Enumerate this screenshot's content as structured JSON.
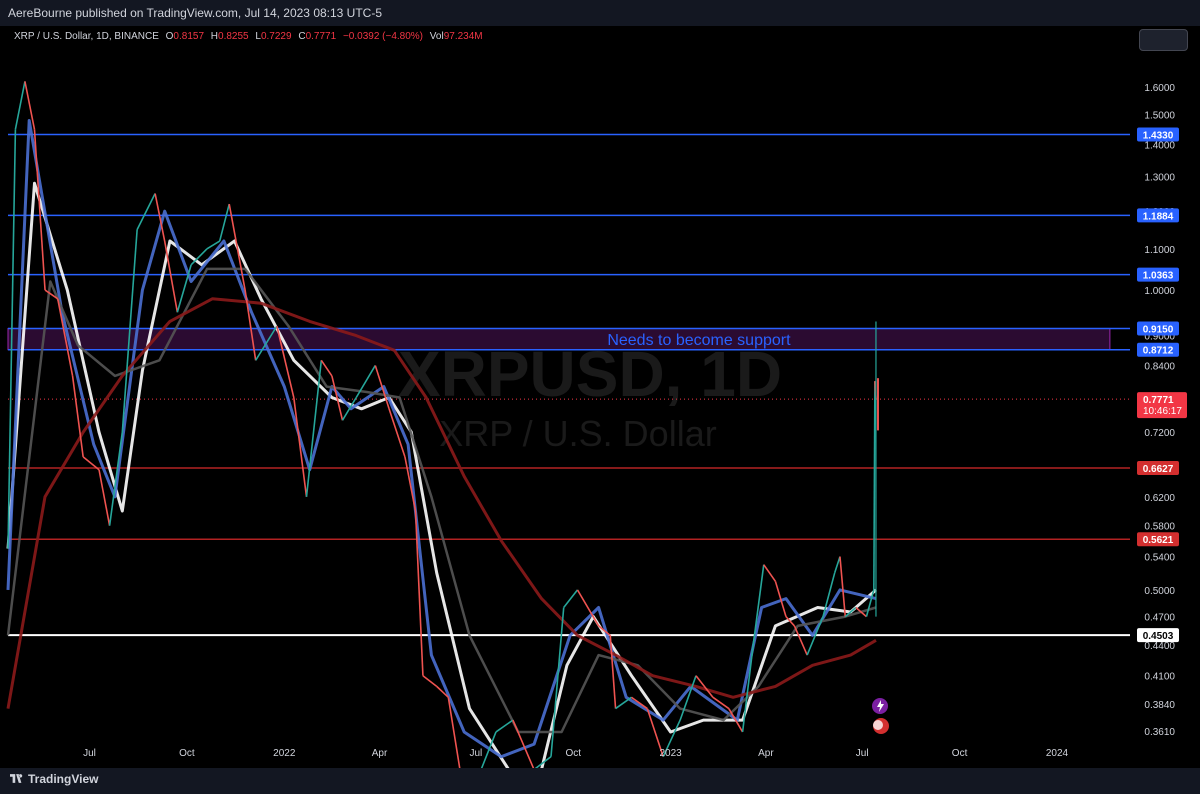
{
  "header": {
    "published_text": "AereBourne published on TradingView.com, Jul 14, 2023 08:13 UTC-5"
  },
  "symbol_bar": {
    "symbol": "XRP / U.S. Dollar, 1D, BINANCE",
    "open_label": "O",
    "open": "0.8157",
    "high_label": "H",
    "high": "0.8255",
    "low_label": "L",
    "low": "0.7229",
    "close_label": "C",
    "close": "0.7771",
    "change": "−0.0392 (−4.80%)",
    "vol_label": "Vol",
    "volume": "97.234M"
  },
  "watermark": {
    "ticker": "XRPUSD, 1D",
    "name": "XRP / U.S. Dollar"
  },
  "footer": {
    "brand": "TradingView"
  },
  "colors": {
    "background": "#000000",
    "blue_level": "#2962ff",
    "red_level": "#b22222",
    "white_level": "#ffffff",
    "zone": "#9c27b0",
    "up": "#26a69a",
    "down": "#ef5350"
  },
  "chart_data": {
    "type": "candlestick",
    "y_scale": "log",
    "ylim": [
      0.355,
      1.75
    ],
    "x_range": [
      "2021-04-15",
      "2024-03-10"
    ],
    "y_ticks": [
      "1.6000",
      "1.5000",
      "1.4000",
      "1.3000",
      "1.2000",
      "1.1000",
      "1.0000",
      "0.9000",
      "0.8400",
      "0.7200",
      "0.6200",
      "0.5800",
      "0.5400",
      "0.5000",
      "0.4700",
      "0.4400",
      "0.4100",
      "0.3840",
      "0.3610"
    ],
    "x_ticks": [
      {
        "label": "Jul",
        "date": "2021-07-01"
      },
      {
        "label": "Oct",
        "date": "2021-10-01"
      },
      {
        "label": "2022",
        "date": "2022-01-01"
      },
      {
        "label": "Apr",
        "date": "2022-04-01"
      },
      {
        "label": "Jul",
        "date": "2022-07-01"
      },
      {
        "label": "Oct",
        "date": "2022-10-01"
      },
      {
        "label": "2023",
        "date": "2023-01-01"
      },
      {
        "label": "Apr",
        "date": "2023-04-01"
      },
      {
        "label": "Jul",
        "date": "2023-07-01"
      },
      {
        "label": "Oct",
        "date": "2023-10-01"
      },
      {
        "label": "2024",
        "date": "2024-01-01"
      }
    ],
    "levels": [
      {
        "value": 1.433,
        "label": "1.4330",
        "color": "#2962ff"
      },
      {
        "value": 1.1884,
        "label": "1.1884",
        "color": "#2962ff"
      },
      {
        "value": 1.0363,
        "label": "1.0363",
        "color": "#2962ff"
      },
      {
        "value": 0.915,
        "label": "0.9150",
        "color": "#2962ff"
      },
      {
        "value": 0.8712,
        "label": "0.8712",
        "color": "#2962ff"
      },
      {
        "value": 0.6627,
        "label": "0.6627",
        "color": "#b22222"
      },
      {
        "value": 0.5621,
        "label": "0.5621",
        "color": "#b22222"
      },
      {
        "value": 0.4503,
        "label": "0.4503",
        "color": "#ffffff"
      }
    ],
    "zone": {
      "low": 0.8712,
      "high": 0.915,
      "start": "2021-04-15",
      "end": "2024-02-20",
      "annotation": "Needs to become support"
    },
    "last_price": {
      "value": 0.7771,
      "label": "0.7771",
      "countdown": "10:46:17"
    },
    "price_path": [
      [
        "2021-04-15",
        0.55
      ],
      [
        "2021-04-22",
        1.45
      ],
      [
        "2021-05-01",
        1.62
      ],
      [
        "2021-05-10",
        1.45
      ],
      [
        "2021-05-20",
        1.0
      ],
      [
        "2021-06-01",
        0.98
      ],
      [
        "2021-06-15",
        0.82
      ],
      [
        "2021-06-25",
        0.68
      ],
      [
        "2021-07-10",
        0.66
      ],
      [
        "2021-07-20",
        0.58
      ],
      [
        "2021-08-01",
        0.72
      ],
      [
        "2021-08-15",
        1.15
      ],
      [
        "2021-09-01",
        1.25
      ],
      [
        "2021-09-10",
        1.12
      ],
      [
        "2021-09-22",
        0.95
      ],
      [
        "2021-10-05",
        1.06
      ],
      [
        "2021-10-20",
        1.1
      ],
      [
        "2021-11-01",
        1.12
      ],
      [
        "2021-11-10",
        1.22
      ],
      [
        "2021-11-25",
        1.0
      ],
      [
        "2021-12-05",
        0.85
      ],
      [
        "2021-12-25",
        0.92
      ],
      [
        "2022-01-10",
        0.78
      ],
      [
        "2022-01-22",
        0.62
      ],
      [
        "2022-02-05",
        0.85
      ],
      [
        "2022-02-15",
        0.82
      ],
      [
        "2022-02-25",
        0.74
      ],
      [
        "2022-03-10",
        0.78
      ],
      [
        "2022-03-28",
        0.84
      ],
      [
        "2022-04-10",
        0.76
      ],
      [
        "2022-04-25",
        0.68
      ],
      [
        "2022-05-05",
        0.6
      ],
      [
        "2022-05-12",
        0.41
      ],
      [
        "2022-05-25",
        0.4
      ],
      [
        "2022-06-05",
        0.39
      ],
      [
        "2022-06-18",
        0.32
      ],
      [
        "2022-07-01",
        0.32
      ],
      [
        "2022-07-20",
        0.36
      ],
      [
        "2022-08-05",
        0.37
      ],
      [
        "2022-08-25",
        0.33
      ],
      [
        "2022-09-10",
        0.34
      ],
      [
        "2022-09-22",
        0.48
      ],
      [
        "2022-10-05",
        0.5
      ],
      [
        "2022-10-25",
        0.46
      ],
      [
        "2022-11-05",
        0.45
      ],
      [
        "2022-11-10",
        0.38
      ],
      [
        "2022-11-25",
        0.39
      ],
      [
        "2022-12-10",
        0.38
      ],
      [
        "2022-12-25",
        0.34
      ],
      [
        "2023-01-10",
        0.37
      ],
      [
        "2023-01-25",
        0.41
      ],
      [
        "2023-02-10",
        0.39
      ],
      [
        "2023-02-25",
        0.38
      ],
      [
        "2023-03-10",
        0.36
      ],
      [
        "2023-03-20",
        0.44
      ],
      [
        "2023-03-30",
        0.53
      ],
      [
        "2023-04-10",
        0.51
      ],
      [
        "2023-04-20",
        0.47
      ],
      [
        "2023-04-28",
        0.46
      ],
      [
        "2023-05-10",
        0.43
      ],
      [
        "2023-05-25",
        0.47
      ],
      [
        "2023-06-05",
        0.52
      ],
      [
        "2023-06-10",
        0.54
      ],
      [
        "2023-06-15",
        0.47
      ],
      [
        "2023-06-25",
        0.48
      ],
      [
        "2023-07-05",
        0.47
      ],
      [
        "2023-07-12",
        0.5
      ],
      [
        "2023-07-13",
        0.81
      ],
      [
        "2023-07-14",
        0.7771
      ]
    ],
    "moving_averages": [
      {
        "color": "#ffffff",
        "points": [
          [
            "2021-04-15",
            0.55
          ],
          [
            "2021-05-10",
            1.28
          ],
          [
            "2021-06-10",
            1.0
          ],
          [
            "2021-07-10",
            0.72
          ],
          [
            "2021-08-01",
            0.6
          ],
          [
            "2021-08-20",
            0.83
          ],
          [
            "2021-09-15",
            1.12
          ],
          [
            "2021-10-15",
            1.06
          ],
          [
            "2021-11-15",
            1.12
          ],
          [
            "2021-12-10",
            0.98
          ],
          [
            "2022-01-10",
            0.85
          ],
          [
            "2022-02-15",
            0.78
          ],
          [
            "2022-03-15",
            0.76
          ],
          [
            "2022-04-10",
            0.78
          ],
          [
            "2022-05-01",
            0.72
          ],
          [
            "2022-05-25",
            0.52
          ],
          [
            "2022-06-25",
            0.38
          ],
          [
            "2022-08-01",
            0.33
          ],
          [
            "2022-09-01",
            0.33
          ],
          [
            "2022-09-25",
            0.42
          ],
          [
            "2022-10-20",
            0.47
          ],
          [
            "2022-11-25",
            0.41
          ],
          [
            "2023-01-01",
            0.36
          ],
          [
            "2023-02-01",
            0.37
          ],
          [
            "2023-03-10",
            0.37
          ],
          [
            "2023-04-10",
            0.46
          ],
          [
            "2023-05-20",
            0.48
          ],
          [
            "2023-06-20",
            0.475
          ],
          [
            "2023-07-14",
            0.5
          ]
        ]
      },
      {
        "color": "#4a6fd1",
        "points": [
          [
            "2021-04-15",
            0.5
          ],
          [
            "2021-05-05",
            1.48
          ],
          [
            "2021-06-05",
            0.95
          ],
          [
            "2021-07-05",
            0.7
          ],
          [
            "2021-07-25",
            0.62
          ],
          [
            "2021-08-20",
            1.0
          ],
          [
            "2021-09-10",
            1.2
          ],
          [
            "2021-10-05",
            1.02
          ],
          [
            "2021-11-05",
            1.12
          ],
          [
            "2021-12-01",
            0.95
          ],
          [
            "2022-01-01",
            0.8
          ],
          [
            "2022-01-25",
            0.66
          ],
          [
            "2022-02-15",
            0.8
          ],
          [
            "2022-03-05",
            0.76
          ],
          [
            "2022-04-05",
            0.8
          ],
          [
            "2022-04-28",
            0.7
          ],
          [
            "2022-05-20",
            0.43
          ],
          [
            "2022-06-20",
            0.36
          ],
          [
            "2022-07-25",
            0.34
          ],
          [
            "2022-08-25",
            0.35
          ],
          [
            "2022-09-28",
            0.45
          ],
          [
            "2022-10-25",
            0.48
          ],
          [
            "2022-11-20",
            0.39
          ],
          [
            "2022-12-25",
            0.37
          ],
          [
            "2023-01-20",
            0.4
          ],
          [
            "2023-03-05",
            0.37
          ],
          [
            "2023-03-28",
            0.48
          ],
          [
            "2023-04-20",
            0.49
          ],
          [
            "2023-05-15",
            0.45
          ],
          [
            "2023-06-10",
            0.5
          ],
          [
            "2023-07-14",
            0.49
          ]
        ]
      },
      {
        "color": "#555555",
        "points": [
          [
            "2021-04-15",
            0.45
          ],
          [
            "2021-05-25",
            1.02
          ],
          [
            "2021-06-20",
            0.88
          ],
          [
            "2021-07-25",
            0.82
          ],
          [
            "2021-09-05",
            0.85
          ],
          [
            "2021-10-20",
            1.05
          ],
          [
            "2021-11-25",
            1.05
          ],
          [
            "2022-01-05",
            0.92
          ],
          [
            "2022-02-10",
            0.8
          ],
          [
            "2022-03-20",
            0.79
          ],
          [
            "2022-04-20",
            0.78
          ],
          [
            "2022-05-20",
            0.62
          ],
          [
            "2022-06-25",
            0.45
          ],
          [
            "2022-08-10",
            0.36
          ],
          [
            "2022-09-20",
            0.36
          ],
          [
            "2022-10-25",
            0.43
          ],
          [
            "2022-12-01",
            0.42
          ],
          [
            "2023-01-10",
            0.38
          ],
          [
            "2023-02-20",
            0.37
          ],
          [
            "2023-03-25",
            0.4
          ],
          [
            "2023-05-01",
            0.46
          ],
          [
            "2023-06-15",
            0.47
          ],
          [
            "2023-07-14",
            0.48
          ]
        ]
      },
      {
        "color": "#8b1a1a",
        "points": [
          [
            "2021-04-15",
            0.38
          ],
          [
            "2021-05-20",
            0.62
          ],
          [
            "2021-06-25",
            0.72
          ],
          [
            "2021-08-01",
            0.82
          ],
          [
            "2021-09-15",
            0.93
          ],
          [
            "2021-10-25",
            0.98
          ],
          [
            "2021-12-10",
            0.97
          ],
          [
            "2022-01-25",
            0.93
          ],
          [
            "2022-03-10",
            0.9
          ],
          [
            "2022-04-15",
            0.87
          ],
          [
            "2022-05-15",
            0.78
          ],
          [
            "2022-06-20",
            0.65
          ],
          [
            "2022-07-25",
            0.56
          ],
          [
            "2022-09-01",
            0.49
          ],
          [
            "2022-10-05",
            0.45
          ],
          [
            "2022-11-10",
            0.43
          ],
          [
            "2022-12-15",
            0.41
          ],
          [
            "2023-01-25",
            0.4
          ],
          [
            "2023-03-01",
            0.39
          ],
          [
            "2023-04-10",
            0.4
          ],
          [
            "2023-05-15",
            0.42
          ],
          [
            "2023-06-20",
            0.43
          ],
          [
            "2023-07-14",
            0.445
          ]
        ]
      }
    ]
  }
}
